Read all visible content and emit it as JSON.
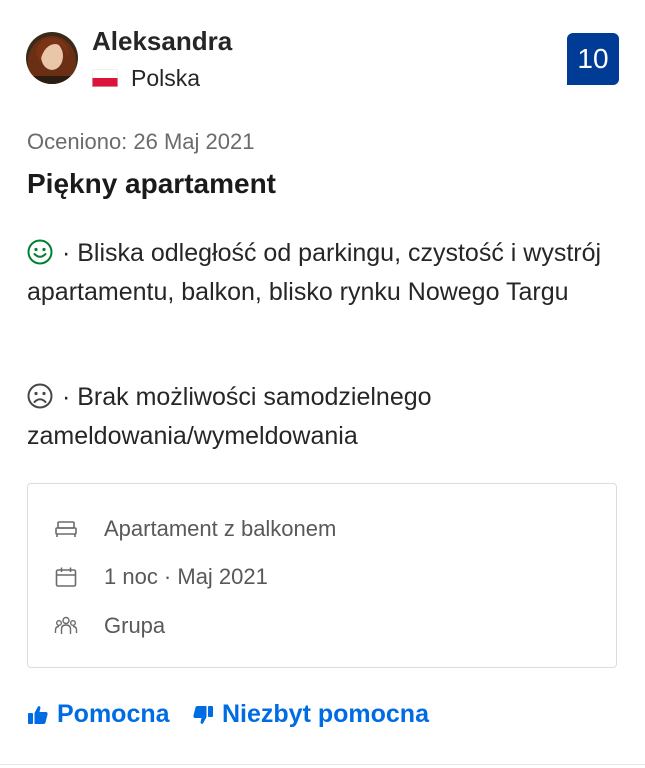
{
  "reviewer": {
    "name": "Aleksandra",
    "country": "Polska",
    "avatar_icon": "avatar-photo",
    "flag_icon": "poland-flag-icon"
  },
  "score": {
    "value": "10",
    "background": "#003b95"
  },
  "review": {
    "date_label": "Oceniono: 26 Maj 2021",
    "title": "Piękny apartament",
    "positive": "· Bliska odległość od parkingu, czystość i wystrój apartamentu, balkon, blisko rynku Nowego Targu",
    "negative": "· Brak możliwości samodzielnego zameldowania/wymeldowania",
    "positive_icon": "smile-icon",
    "negative_icon": "frown-icon",
    "positive_color": "#008234"
  },
  "stay_details": {
    "room": "Apartament z balkonem",
    "stay": "1 noc · Maj 2021",
    "traveler_type": "Grupa",
    "room_icon": "bed-icon",
    "stay_icon": "calendar-icon",
    "traveler_icon": "group-icon"
  },
  "actions": {
    "helpful_label": "Pomocna",
    "not_helpful_label": "Niezbyt pomocna",
    "helpful_icon": "thumbs-up-icon",
    "not_helpful_icon": "thumbs-down-icon",
    "link_color": "#006ce4"
  }
}
